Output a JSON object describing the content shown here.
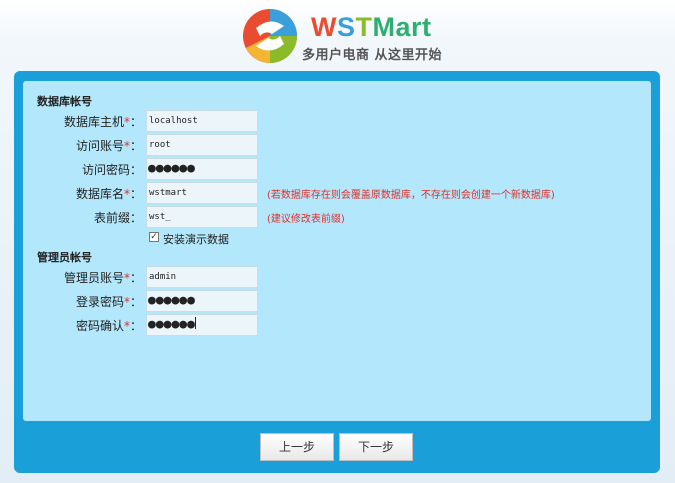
{
  "logo": {
    "brand_w": "W",
    "brand_s": "S",
    "brand_t": "T",
    "brand_rest": "Mart",
    "tagline": "多用户电商 从这里开始"
  },
  "colors": {
    "frame": "#1a9fd9",
    "panel": "#b3e7fc",
    "required": "#e0302a"
  },
  "db_section": {
    "title": "数据库帐号",
    "host": {
      "label": "数据库主机",
      "required": "*",
      "colon": "：",
      "value": "localhost"
    },
    "user": {
      "label": "访问账号",
      "required": "*",
      "colon": "：",
      "value": "root"
    },
    "password": {
      "label": "访问密码",
      "colon": "：",
      "value": "●●●●●●"
    },
    "db_name": {
      "label": "数据库名",
      "required": "*",
      "colon": "：",
      "value": "wstmart",
      "hint": "(若数据库存在则会覆盖原数据库，不存在则会创建一个新数据库)"
    },
    "prefix": {
      "label": "表前缀",
      "colon": "：",
      "value": "wst_",
      "hint": "(建议修改表前缀)"
    },
    "demo_data": {
      "label": "安装演示数据",
      "checked": true,
      "check_mark": "✓"
    }
  },
  "admin_section": {
    "title": "管理员帐号",
    "account": {
      "label": "管理员账号",
      "required": "*",
      "colon": "：",
      "value": "admin"
    },
    "password": {
      "label": "登录密码",
      "required": "*",
      "colon": "：",
      "value": "●●●●●●"
    },
    "confirm": {
      "label": "密码确认",
      "required": "*",
      "colon": "：",
      "value": "●●●●●●"
    }
  },
  "buttons": {
    "prev": "上一步",
    "next": "下一步"
  }
}
